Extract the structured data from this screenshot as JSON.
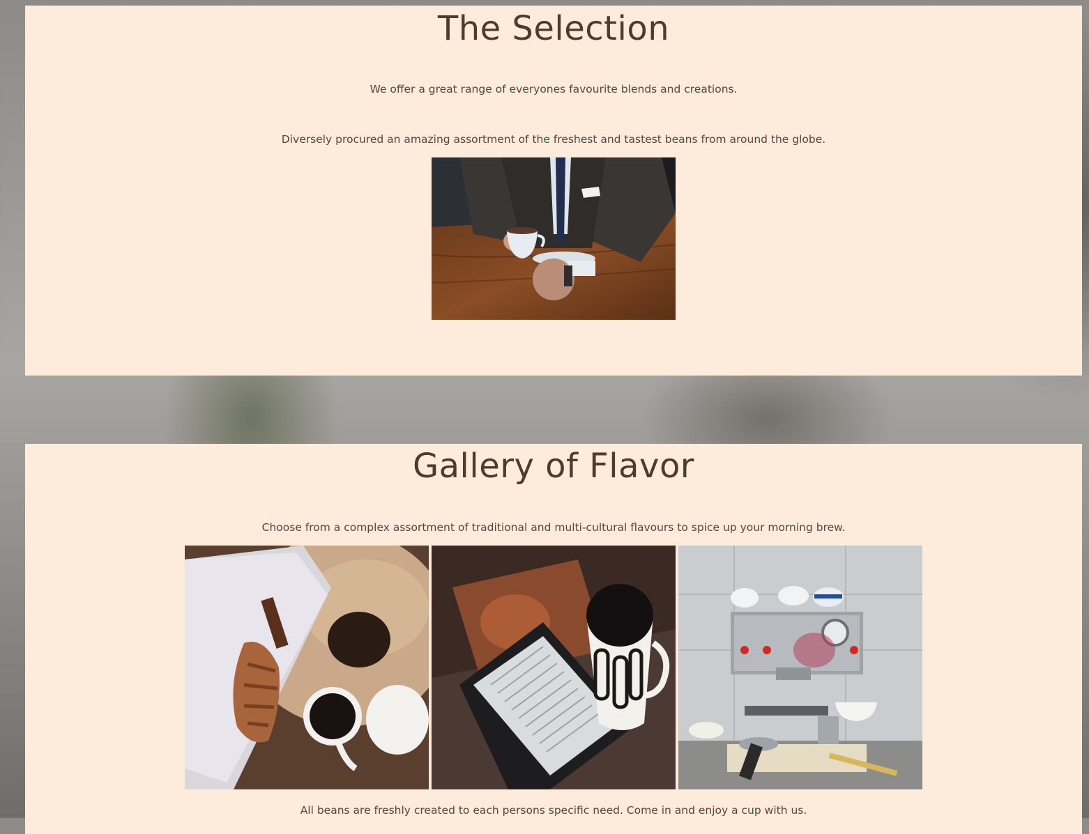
{
  "selection": {
    "title": "The Selection",
    "paragraphs": [
      "We offer a great range of everyones favourite blends and creations.",
      "Diversely procured an amazing assortment of the freshest and tastest beans from around the globe."
    ]
  },
  "gallery": {
    "title": "Gallery of Flavor",
    "intro": "Choose from a complex assortment of traditional and multi-cultural flavours to spice up your morning brew.",
    "outro": "All beans are freshly created to each persons specific need. Come in and enjoy a cup with us."
  },
  "colors": {
    "card_background": "#fdebdc",
    "heading_text": "#4f3a2b",
    "body_text": "#5a4536"
  }
}
